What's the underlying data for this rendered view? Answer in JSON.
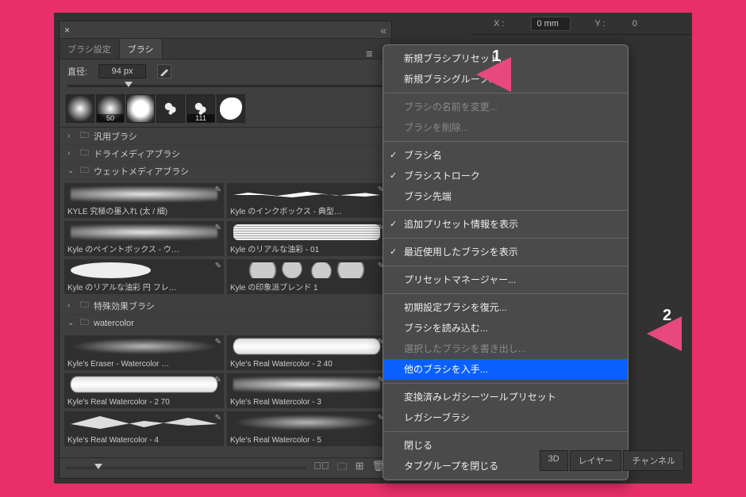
{
  "coord": {
    "xLabel": "X :",
    "xVal": "0 mm",
    "yLabel": "Y :",
    "yVal": "0"
  },
  "tabs": {
    "settings": "ブラシ設定",
    "brushes": "ブラシ"
  },
  "diameter": {
    "label": "直径:",
    "value": "94 px"
  },
  "strip": {
    "n1": "50",
    "n2": "111"
  },
  "folders": {
    "general": "汎用ブラシ",
    "dry": "ドライメディアブラシ",
    "wet": "ウェットメディアブラシ",
    "fx": "特殊効果ブラシ",
    "wc": "watercolor"
  },
  "wet": [
    "KYLE 究極の墨入れ (太 / 細)",
    "Kyle のインクボックス  - 典型…",
    "Kyle のペイントボックス - ウ…",
    "Kyle のリアルな油彩 - 01",
    "Kyle のリアルな油彩 円 フレ…",
    "Kyle の印象派ブレンド 1"
  ],
  "wc": [
    "Kyle's Eraser - Watercolor …",
    "Kyle's Real Watercolor - 2 40",
    "Kyle's Real Watercolor - 2 70",
    "Kyle's Real Watercolor - 3",
    "Kyle's Real Watercolor - 4",
    "Kyle's Real Watercolor - 5"
  ],
  "menu": {
    "newPreset": "新規ブラシプリセット...",
    "newGroup": "新規ブラシグループ...",
    "rename": "ブラシの名前を変更...",
    "delete": "ブラシを削除...",
    "brushName": "ブラシ名",
    "brushStroke": "ブラシストローク",
    "brushTip": "ブラシ先端",
    "showPreset": "追加プリセット情報を表示",
    "showRecent": "最近使用したブラシを表示",
    "presetMgr": "プリセットマネージャー...",
    "restore": "初期設定ブラシを復元...",
    "load": "ブラシを読み込む...",
    "export": "選択したブラシを書き出し...",
    "getMore": "他のブラシを入手...",
    "legacyConv": "変換済みレガシーツールプリセット",
    "legacy": "レガシーブラシ",
    "close": "閉じる",
    "closeGroup": "タブグループを閉じる"
  },
  "lowerTabs": {
    "a": "3D",
    "b": "レイヤー",
    "c": "チャンネル"
  },
  "callouts": {
    "one": "1",
    "two": "2"
  }
}
